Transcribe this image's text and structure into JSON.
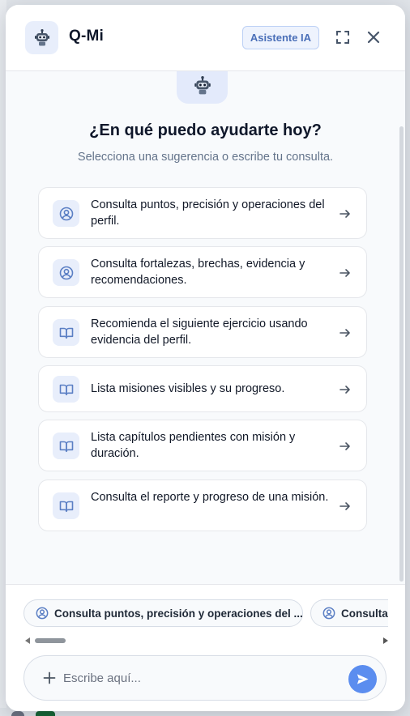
{
  "header": {
    "title": "Q-Mi",
    "badge": "Asistente IA",
    "logo_icon": "robot-icon",
    "expand_icon": "expand-icon",
    "close_icon": "close-icon"
  },
  "welcome": {
    "icon": "robot-icon",
    "headline": "¿En qué puedo ayudarte hoy?",
    "subline": "Selecciona una sugerencia o escribe tu consulta."
  },
  "suggestions": [
    {
      "icon": "user-circle-icon",
      "text": "Consulta puntos, precisión y operaciones del perfil."
    },
    {
      "icon": "user-circle-icon",
      "text": "Consulta fortalezas, brechas, evidencia y recomendaciones."
    },
    {
      "icon": "book-open-icon",
      "text": "Recomienda el siguiente ejercicio usando evidencia del perfil."
    },
    {
      "icon": "book-open-icon",
      "text": "Lista misiones visibles y su progreso."
    },
    {
      "icon": "book-open-icon",
      "text": "Lista capítulos pendientes con misión y duración."
    },
    {
      "icon": "book-open-icon",
      "text": "Consulta el reporte y progreso de una misión."
    }
  ],
  "quick_chips": [
    {
      "icon": "user-circle-icon",
      "label": "Consulta puntos, precisión y operaciones del ..."
    },
    {
      "icon": "user-circle-icon",
      "label": "Consulta"
    }
  ],
  "composer": {
    "placeholder": "Escribe aquí...",
    "value": "",
    "plus_icon": "plus-icon",
    "send_icon": "send-icon"
  },
  "colors": {
    "accent": "#5b8def",
    "icon_bg": "#e8eefb",
    "icon_stroke": "#5b7fc4",
    "badge_text": "#4a6fb8"
  }
}
